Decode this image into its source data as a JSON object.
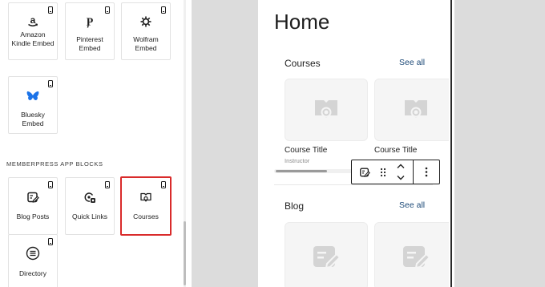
{
  "inserter": {
    "embed_blocks": [
      {
        "label": "Amazon Kindle Embed",
        "icon": "amazon-icon"
      },
      {
        "label": "Pinterest Embed",
        "icon": "pinterest-icon"
      },
      {
        "label": "Wolfram Embed",
        "icon": "wolfram-icon"
      },
      {
        "label": "Bluesky Embed",
        "icon": "bluesky-icon"
      }
    ],
    "section_heading": "MEMBERPRESS APP BLOCKS",
    "app_blocks": [
      {
        "label": "Blog Posts",
        "icon": "blog-posts-icon"
      },
      {
        "label": "Quick Links",
        "icon": "quick-links-icon"
      },
      {
        "label": "Courses",
        "icon": "courses-icon",
        "selected": true
      },
      {
        "label": "Directory",
        "icon": "directory-icon"
      }
    ],
    "highlight_color": "#d92b2b"
  },
  "preview": {
    "page_title": "Home",
    "courses": {
      "title": "Courses",
      "see_all": "See all",
      "cards": [
        {
          "title": "Course Title",
          "subtitle": "Instructor"
        },
        {
          "title": "Course Title"
        }
      ]
    },
    "blog": {
      "title": "Blog",
      "see_all": "See all"
    },
    "link_color": "#1d4a78"
  },
  "block_toolbar": {
    "items": [
      "block-type-icon",
      "drag-handle-icon",
      "move-up-icon",
      "move-down-icon",
      "more-options-icon"
    ]
  }
}
